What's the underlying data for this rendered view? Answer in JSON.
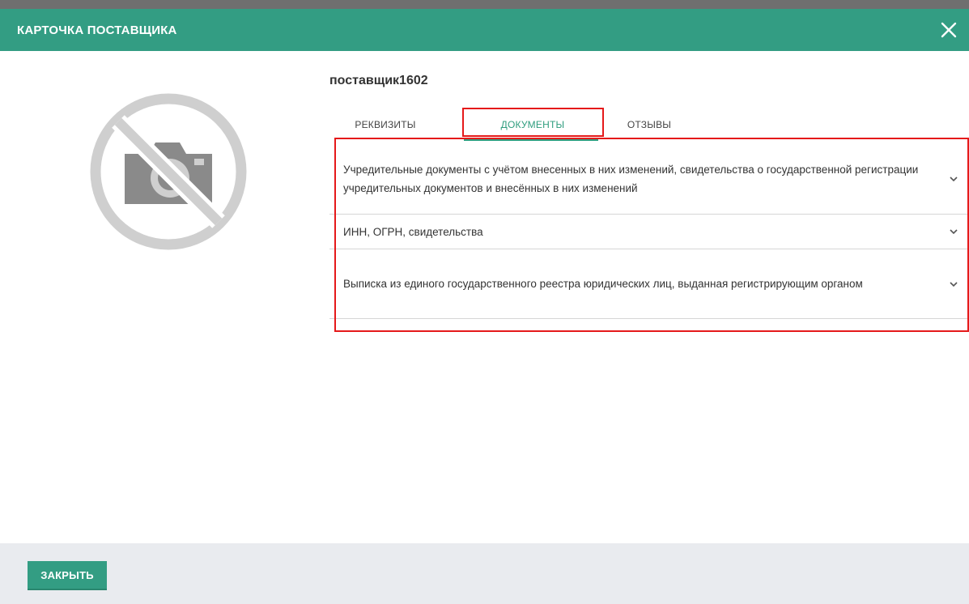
{
  "header": {
    "title": "КАРТОЧКА ПОСТАВЩИКА",
    "close_icon": "close-icon"
  },
  "supplier": {
    "name": "поставщик1602",
    "photo_icon": "no-photo-icon"
  },
  "tabs": [
    {
      "label": "РЕКВИЗИТЫ",
      "active": false
    },
    {
      "label": "ДОКУМЕНТЫ",
      "active": true
    },
    {
      "label": "ОТЗЫВЫ",
      "active": false
    }
  ],
  "documents": [
    {
      "label": "Учредительные документы с учётом внесенных в них изменений, свидетельства о государственной регистрации учредительных документов и внесённых в них изменений"
    },
    {
      "label": "ИНН, ОГРН, свидетельства"
    },
    {
      "label": "Выписка из единого государственного реестра юридических лиц, выданная регистрирующим органом"
    }
  ],
  "footer": {
    "close_label": "ЗАКРЫТЬ"
  },
  "colors": {
    "accent": "#339d83",
    "highlight": "#e5191a",
    "footer_bg": "#e9ebef"
  }
}
